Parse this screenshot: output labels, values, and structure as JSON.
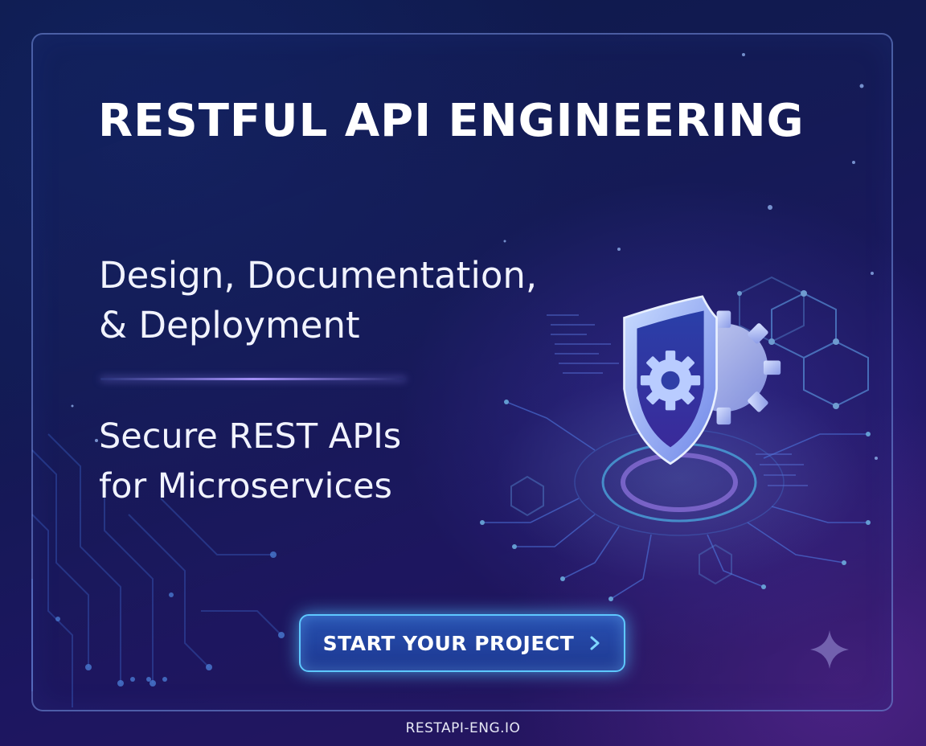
{
  "banner": {
    "headline": "RESTFUL API ENGINEERING",
    "subhead_line1": "Design, Documentation,",
    "subhead_line2": "& Deployment",
    "tagline_line1": "Secure REST APIs",
    "tagline_line2": "for Microservices",
    "cta_label": "START YOUR PROJECT",
    "cta_icon": "chevron-right-icon",
    "footer_url": "RESTAPI-ENG.IO",
    "illustration": "shield-gear-icon",
    "sparkle": "sparkle-icon"
  },
  "colors": {
    "background": "#0e1a4a",
    "accent_cyan": "#5ec8ff",
    "accent_violet": "#a98bff",
    "text": "#ffffff"
  }
}
